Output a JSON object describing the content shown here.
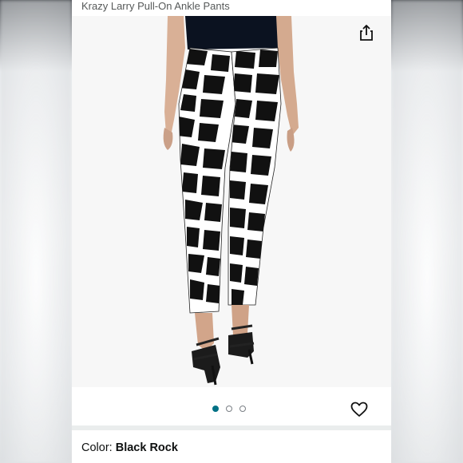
{
  "product": {
    "title": "Krazy Larry Pull-On Ankle Pants"
  },
  "gallery": {
    "image_count": 3,
    "active_index": 0,
    "share_icon": "share-icon",
    "wishlist_icon": "heart-icon"
  },
  "color": {
    "label": "Color:",
    "value": "Black Rock"
  },
  "colors": {
    "accent": "#007185",
    "text": "#0f1111",
    "muted": "#565959"
  }
}
